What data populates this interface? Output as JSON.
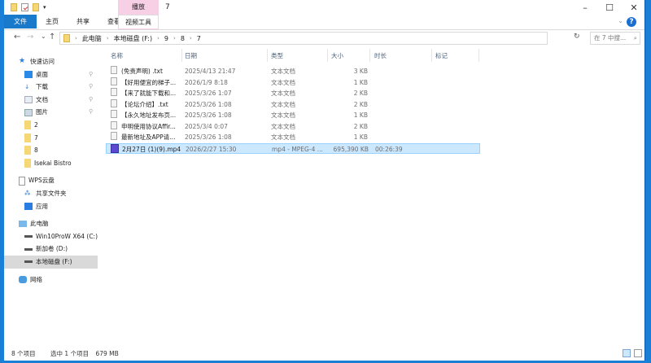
{
  "window": {
    "title": "7",
    "context_group": "播放",
    "minimize": "–",
    "maximize": "☐",
    "close": "✕",
    "help": "?",
    "collapse": "⌄"
  },
  "ribbon": {
    "tabs": [
      "文件",
      "主页",
      "共享",
      "查看"
    ],
    "context_tab": "视频工具"
  },
  "nav": {
    "back": "←",
    "forward": "→",
    "recent": "⌄",
    "up": "↑",
    "breadcrumb": [
      "此电脑",
      "本地磁盘 (F:)",
      "9",
      "8",
      "7"
    ],
    "search_placeholder": "在 7 中搜...",
    "refresh": "↻",
    "search_icon": "⌕"
  },
  "sidebar": [
    {
      "label": "快速访问",
      "icon": "star-icon"
    },
    {
      "label": "桌面",
      "icon": "desktop-icon",
      "pinned": true
    },
    {
      "label": "下载",
      "icon": "download-icon",
      "pinned": true
    },
    {
      "label": "文档",
      "icon": "document-icon",
      "pinned": true
    },
    {
      "label": "图片",
      "icon": "picture-icon",
      "pinned": true
    },
    {
      "label": "2",
      "icon": "folder-icon"
    },
    {
      "label": "7",
      "icon": "folder-icon"
    },
    {
      "label": "8",
      "icon": "folder-icon"
    },
    {
      "label": "Isekai Bistro",
      "icon": "folder-icon"
    },
    {
      "label": "WPS云盘",
      "icon": "cloud-doc-icon"
    },
    {
      "label": "共享文件夹",
      "icon": "share-icon"
    },
    {
      "label": "应用",
      "icon": "apps-icon"
    },
    {
      "label": "此电脑",
      "icon": "computer-icon"
    },
    {
      "label": "Win10ProW X64 (C:)",
      "icon": "drive-icon"
    },
    {
      "label": "新加卷 (D:)",
      "icon": "drive-icon"
    },
    {
      "label": "本地磁盘 (F:)",
      "icon": "drive-icon",
      "selected": true
    },
    {
      "label": "网络",
      "icon": "network-icon"
    }
  ],
  "columns": [
    "名称",
    "日期",
    "类型",
    "大小",
    "时长",
    "标记"
  ],
  "files": [
    {
      "name": "(免责声明) .txt",
      "date": "2025/4/13 21:47",
      "type": "文本文档",
      "size": "3 KB",
      "duration": ""
    },
    {
      "name": "【好用便宜的梯子...",
      "date": "2026/1/9 8:18",
      "type": "文本文档",
      "size": "1 KB",
      "duration": ""
    },
    {
      "name": "【来了就能下载和...",
      "date": "2025/3/26 1:07",
      "type": "文本文档",
      "size": "2 KB",
      "duration": ""
    },
    {
      "name": "【论坛介绍】.txt",
      "date": "2025/3/26 1:08",
      "type": "文本文档",
      "size": "2 KB",
      "duration": ""
    },
    {
      "name": "【永久地址发布页...",
      "date": "2025/3/26 1:08",
      "type": "文本文档",
      "size": "1 KB",
      "duration": ""
    },
    {
      "name": "申明使用协议Affir...",
      "date": "2025/3/4 0:07",
      "type": "文本文档",
      "size": "2 KB",
      "duration": ""
    },
    {
      "name": "最新地址及APP请...",
      "date": "2025/3/26 1:08",
      "type": "文本文档",
      "size": "1 KB",
      "duration": ""
    },
    {
      "name": "2月27日 (1)(9).mp4",
      "date": "2026/2/27 15:30",
      "type": "mp4 - MPEG-4 ...",
      "size": "695,390 KB",
      "duration": "00:26:39",
      "selected": true
    }
  ],
  "status": {
    "count": "8 个项目",
    "selected": "选中 1 个项目",
    "size": "679 MB"
  },
  "colors": {
    "file_tab": "#1979ca",
    "context_tab": "#f7d0e6",
    "selection": "#cce8ff",
    "sidebar_selected": "#d9d9d9"
  }
}
